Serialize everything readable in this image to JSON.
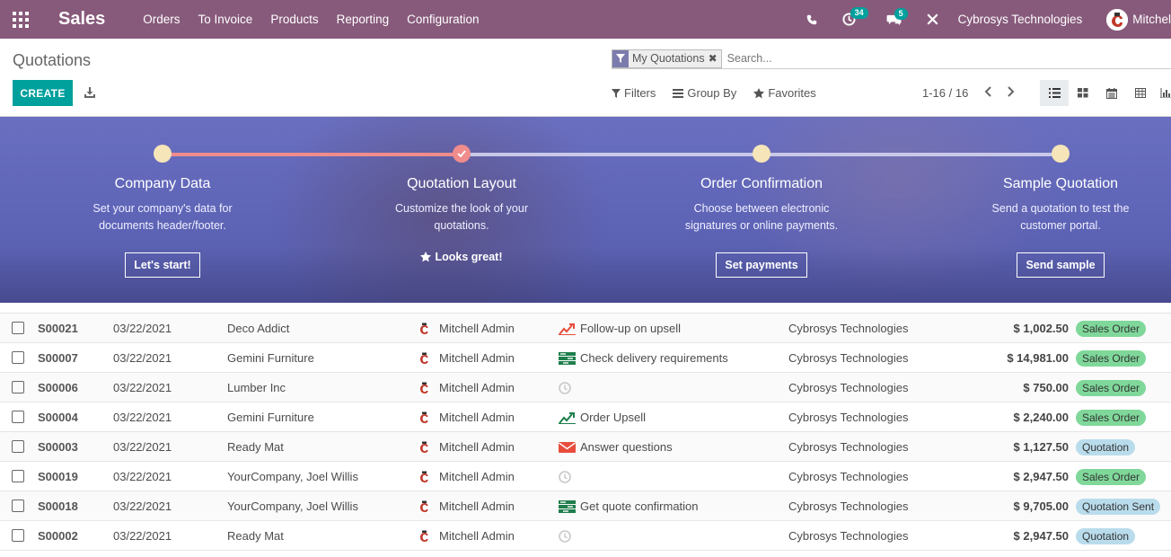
{
  "navbar": {
    "app_name": "Sales",
    "menu": [
      "Orders",
      "To Invoice",
      "Products",
      "Reporting",
      "Configuration"
    ],
    "activity_count": "34",
    "message_count": "5",
    "company": "Cybrosys Technologies",
    "user": "Mitchel"
  },
  "control_panel": {
    "title": "Quotations",
    "create_label": "CREATE",
    "facet_label": "My Quotations",
    "search_placeholder": "Search...",
    "filters_label": "Filters",
    "groupby_label": "Group By",
    "favorites_label": "Favorites",
    "pager": "1-16 / 16"
  },
  "onboarding": {
    "steps": [
      {
        "title": "Company Data",
        "desc": "Set your company's data for documents header/footer.",
        "button": "Let's start!"
      },
      {
        "title": "Quotation Layout",
        "desc": "Customize the look of your quotations.",
        "done_msg": "Looks great!"
      },
      {
        "title": "Order Confirmation",
        "desc": "Choose between electronic signatures or online payments.",
        "button": "Set payments"
      },
      {
        "title": "Sample Quotation",
        "desc": "Send a quotation to test the customer portal.",
        "button": "Send sample"
      }
    ]
  },
  "rows": [
    {
      "number": "S00021",
      "date": "03/22/2021",
      "customer": "Deco Addict",
      "salesperson": "Mitchell Admin",
      "activity_icon": "trend-up-red-icon",
      "activity": "Follow-up on upsell",
      "company": "Cybrosys Technologies",
      "total": "$ 1,002.50",
      "status": "Sales Order",
      "status_kind": "sales"
    },
    {
      "number": "S00007",
      "date": "03/22/2021",
      "customer": "Gemini Furniture",
      "salesperson": "Mitchell Admin",
      "activity_icon": "tasks-icon",
      "activity": "Check delivery requirements",
      "company": "Cybrosys Technologies",
      "total": "$ 14,981.00",
      "status": "Sales Order",
      "status_kind": "sales"
    },
    {
      "number": "S00006",
      "date": "03/22/2021",
      "customer": "Lumber Inc",
      "salesperson": "Mitchell Admin",
      "activity_icon": "clock-icon",
      "activity": "",
      "company": "Cybrosys Technologies",
      "total": "$ 750.00",
      "status": "Sales Order",
      "status_kind": "sales"
    },
    {
      "number": "S00004",
      "date": "03/22/2021",
      "customer": "Gemini Furniture",
      "salesperson": "Mitchell Admin",
      "activity_icon": "trend-up-green-icon",
      "activity": "Order Upsell",
      "company": "Cybrosys Technologies",
      "total": "$ 2,240.00",
      "status": "Sales Order",
      "status_kind": "sales"
    },
    {
      "number": "S00003",
      "date": "03/22/2021",
      "customer": "Ready Mat",
      "salesperson": "Mitchell Admin",
      "activity_icon": "envelope-icon",
      "activity": "Answer questions",
      "company": "Cybrosys Technologies",
      "total": "$ 1,127.50",
      "status": "Quotation",
      "status_kind": "quot"
    },
    {
      "number": "S00019",
      "date": "03/22/2021",
      "customer": "YourCompany, Joel Willis",
      "salesperson": "Mitchell Admin",
      "activity_icon": "clock-icon",
      "activity": "",
      "company": "Cybrosys Technologies",
      "total": "$ 2,947.50",
      "status": "Sales Order",
      "status_kind": "sales"
    },
    {
      "number": "S00018",
      "date": "03/22/2021",
      "customer": "YourCompany, Joel Willis",
      "salesperson": "Mitchell Admin",
      "activity_icon": "tasks-icon",
      "activity": "Get quote confirmation",
      "company": "Cybrosys Technologies",
      "total": "$ 9,705.00",
      "status": "Quotation Sent",
      "status_kind": "quot"
    },
    {
      "number": "S00002",
      "date": "03/22/2021",
      "customer": "Ready Mat",
      "salesperson": "Mitchell Admin",
      "activity_icon": "clock-icon",
      "activity": "",
      "company": "Cybrosys Technologies",
      "total": "$ 2,947.50",
      "status": "Quotation",
      "status_kind": "quot"
    }
  ],
  "colors": {
    "navbar": "#875a7b",
    "primary": "#00a09d",
    "sales_order": "#7fd89a",
    "quotation": "#b9dcec"
  }
}
